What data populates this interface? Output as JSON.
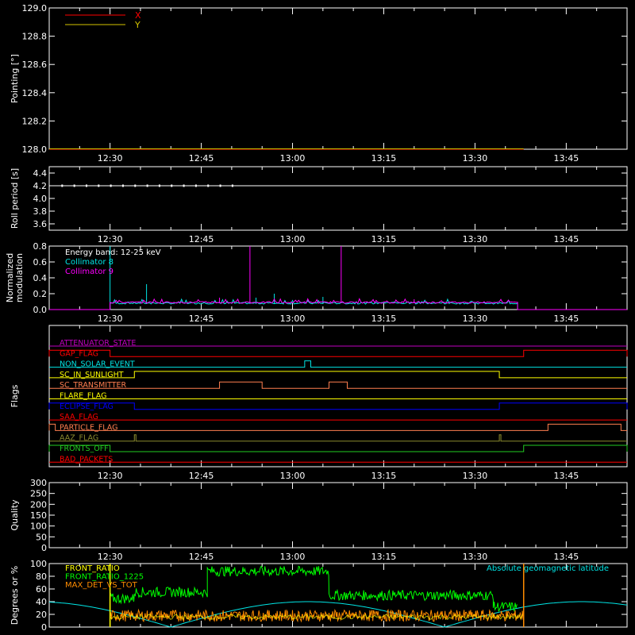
{
  "colors": {
    "frame": "#ffffff",
    "x": "#ff0000",
    "y": "#d4c400",
    "cyan": "#00e5e5",
    "magenta": "#ff00ff",
    "green": "#00ff00",
    "orange": "#ff8c00",
    "yellow": "#ffff00",
    "blue": "#0000ff",
    "red": "#ff0000",
    "olive": "#8b8b2e",
    "purple": "#c000c0",
    "softorange": "#ff7f50",
    "midgreen": "#22cc22"
  },
  "time_axis": {
    "range": [
      "12:20",
      "13:55"
    ],
    "ticks": [
      "12:30",
      "12:45",
      "13:00",
      "13:15",
      "13:30",
      "13:45"
    ]
  },
  "chart_data": [
    {
      "type": "line",
      "id": "pointing",
      "ylabel": "Pointing [°]",
      "ylim": [
        128.0,
        129.0
      ],
      "yticks": [
        "128.0",
        "128.2",
        "128.4",
        "128.6",
        "128.8",
        "129.0"
      ],
      "legend": "top-left",
      "series": [
        {
          "name": "X",
          "color": "#ff0000",
          "x": [
            "12:20",
            "13:38"
          ],
          "values": [
            128.0,
            128.0
          ]
        },
        {
          "name": "Y",
          "color": "#d4c400",
          "x": [
            "12:20",
            "13:38"
          ],
          "values": [
            128.0,
            128.0
          ]
        }
      ]
    },
    {
      "type": "line",
      "id": "roll",
      "ylabel": "Roll period [s]",
      "ylim": [
        3.5,
        4.5
      ],
      "yticks": [
        "3.6",
        "3.8",
        "4.0",
        "4.2",
        "4.4"
      ],
      "series": [
        {
          "name": "",
          "color": "#ffffff",
          "x": [
            "12:20",
            "13:55"
          ],
          "values": [
            4.2,
            4.2
          ]
        }
      ]
    },
    {
      "type": "line",
      "id": "modulation",
      "ylabel": "Normalized modulation",
      "ylim": [
        0.0,
        0.8
      ],
      "yticks": [
        "0.0",
        "0.2",
        "0.4",
        "0.6",
        "0.8"
      ],
      "annotation": "Energy band: 12-25 keV",
      "active_range": [
        "12:30",
        "13:37"
      ],
      "series": [
        {
          "name": "Collimator 8",
          "color": "#00e5e5",
          "baseline": 0.07,
          "spikes": [
            [
              "12:30",
              0.8
            ],
            [
              "12:36",
              0.32
            ],
            [
              "12:54",
              0.15
            ],
            [
              "12:57",
              0.2
            ],
            [
              "13:05",
              0.16
            ]
          ]
        },
        {
          "name": "Collimator 9",
          "color": "#ff00ff",
          "baseline": 0.08,
          "spikes": [
            [
              "12:53",
              0.8
            ],
            [
              "13:08",
              0.8
            ],
            [
              "12:48",
              0.15
            ],
            [
              "13:20",
              0.13
            ]
          ]
        }
      ]
    },
    {
      "type": "line",
      "id": "flags",
      "ylabel": "Flags",
      "flags": [
        {
          "name": "ATTENUATOR_STATE",
          "color": "#c000c0",
          "high": []
        },
        {
          "name": "GAP_FLAG",
          "color": "#ff0000",
          "high": [
            [
              "12:20",
              "12:30"
            ],
            [
              "13:38",
              "13:55"
            ]
          ]
        },
        {
          "name": "NON_SOLAR_EVENT",
          "color": "#00e5e5",
          "high": [
            [
              "13:02",
              "13:03"
            ]
          ]
        },
        {
          "name": "SC_IN_SUNLIGHT",
          "color": "#ffff00",
          "high": [
            [
              "12:34",
              "13:34"
            ]
          ]
        },
        {
          "name": "SC_TRANSMITTER",
          "color": "#ff7f50",
          "high": [
            [
              "12:48",
              "12:55"
            ],
            [
              "13:06",
              "13:09"
            ]
          ]
        },
        {
          "name": "FLARE_FLAG",
          "color": "#ffff00",
          "high": []
        },
        {
          "name": "ECLIPSE_FLAG",
          "color": "#0000ff",
          "high": [
            [
              "12:20",
              "12:34"
            ],
            [
              "13:34",
              "13:55"
            ]
          ]
        },
        {
          "name": "SAA_FLAG",
          "color": "#ff0000",
          "high": []
        },
        {
          "name": "PARTICLE_FLAG",
          "color": "#ff7f50",
          "high": [
            [
              "12:20",
              "12:21"
            ],
            [
              "13:42",
              "13:54"
            ]
          ]
        },
        {
          "name": "AAZ_FLAG",
          "color": "#8b8b2e",
          "high": [
            [
              "12:34",
              "12:34"
            ],
            [
              "13:34",
              "13:34"
            ]
          ]
        },
        {
          "name": "FRONTS_OFF",
          "color": "#22cc22",
          "high": [
            [
              "12:20",
              "12:30"
            ],
            [
              "13:38",
              "13:55"
            ]
          ]
        },
        {
          "name": "BAD_PACKETS",
          "color": "#ff0000",
          "high": []
        }
      ]
    },
    {
      "type": "line",
      "id": "quality",
      "ylabel": "Quality",
      "ylim": [
        0,
        300
      ],
      "yticks": [
        "0",
        "50",
        "100",
        "150",
        "200",
        "250",
        "300"
      ],
      "series": []
    },
    {
      "type": "line",
      "id": "ratios",
      "ylabel": "Degrees or %",
      "ylim": [
        0,
        100
      ],
      "yticks": [
        "0",
        "20",
        "40",
        "60",
        "80",
        "100"
      ],
      "annotation": "Absolute geomagnetic latitude",
      "series": [
        {
          "name": "FRONT_RATIO",
          "color": "#ffff00",
          "x": [
            "12:30",
            "13:38"
          ],
          "values": [
            20,
            20
          ]
        },
        {
          "name": "FRONT_RATIO_1225",
          "color": "#00ff00",
          "segments": [
            [
              "12:30",
              "12:34",
              45
            ],
            [
              "12:34",
              "12:46",
              55
            ],
            [
              "12:46",
              "13:06",
              88
            ],
            [
              "13:06",
              "13:33",
              50
            ],
            [
              "13:33",
              "13:37",
              32
            ]
          ]
        },
        {
          "name": "MAX_DET_VS_TOT",
          "color": "#ff8c00",
          "x": [
            "12:30",
            "13:38"
          ],
          "values": [
            20,
            20
          ]
        },
        {
          "name": "Absolute geomagnetic latitude",
          "color": "#00e5e5",
          "amplitude": 40,
          "period_min": 90
        }
      ]
    }
  ]
}
